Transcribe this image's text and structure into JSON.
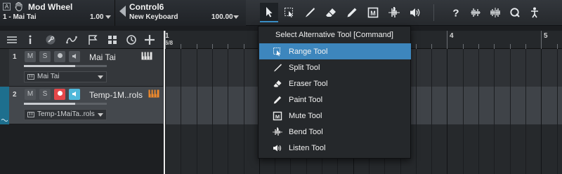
{
  "controllers": [
    {
      "chip": "A",
      "name": "Mod Wheel",
      "sub": "1 - Mai Tai",
      "value": "1.00"
    },
    {
      "name": "Control6",
      "sub": "New Keyboard",
      "value": "100.00"
    }
  ],
  "toolbar": {
    "tools": [
      {
        "id": "arrow",
        "icon": "arrow-pointer-icon",
        "active": true
      },
      {
        "id": "range",
        "icon": "range-icon"
      },
      {
        "id": "split",
        "icon": "split-knife-icon"
      },
      {
        "id": "eraser",
        "icon": "eraser-icon"
      },
      {
        "id": "paint",
        "icon": "pencil-icon"
      },
      {
        "id": "mute",
        "icon": "mute-icon"
      },
      {
        "id": "bend",
        "icon": "bend-icon"
      },
      {
        "id": "listen",
        "icon": "speaker-icon"
      },
      {
        "id": "help",
        "icon": "question-icon"
      },
      {
        "id": "snap-audio",
        "icon": "audio-wave-icon"
      },
      {
        "id": "snap-event",
        "icon": "wave-snap-icon"
      },
      {
        "id": "quantize",
        "icon": "quantize-q-icon"
      },
      {
        "id": "autoscroll",
        "icon": "figure-icon"
      }
    ]
  },
  "tracks": [
    {
      "number": "1",
      "mute": "M",
      "solo": "S",
      "name": "Mai Tai",
      "device": "Mai Tai",
      "selected": false,
      "record_armed": false,
      "monitor_on": false,
      "volume": 0.62
    },
    {
      "number": "2",
      "mute": "M",
      "solo": "S",
      "name": "Temp-1M..rols",
      "device": "Temp-1MaiTa..rols",
      "selected": true,
      "record_armed": true,
      "monitor_on": true,
      "volume": 0.62
    }
  ],
  "ruler": {
    "time_signature": "6/8",
    "bars": [
      "1",
      "4",
      "5"
    ]
  },
  "menu": {
    "title": "Select Alternative Tool [Command]",
    "items": [
      {
        "label": "Range Tool",
        "icon": "range-icon",
        "highlighted": true
      },
      {
        "label": "Split Tool",
        "icon": "split-knife-icon"
      },
      {
        "label": "Eraser Tool",
        "icon": "eraser-icon"
      },
      {
        "label": "Paint Tool",
        "icon": "pencil-icon"
      },
      {
        "label": "Mute Tool",
        "icon": "mute-icon"
      },
      {
        "label": "Bend Tool",
        "icon": "bend-icon"
      },
      {
        "label": "Listen Tool",
        "icon": "speaker-icon"
      }
    ]
  },
  "colors": {
    "accent": "#3d86bd",
    "record": "#e4474a",
    "monitor": "#4fb8da",
    "track_select": "#1e6f8e"
  }
}
